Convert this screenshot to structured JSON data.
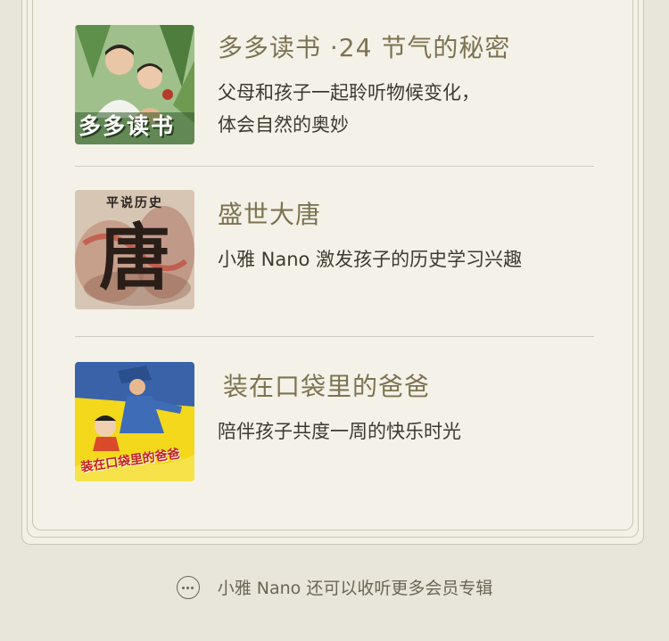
{
  "albums": [
    {
      "title": "多多读书 ·24 节气的秘密",
      "desc_lines": [
        "父母和孩子一起聆听物候变化，",
        "体会自然的奥妙"
      ],
      "cover_text": "多多读书"
    },
    {
      "title": "盛世大唐",
      "desc_lines": [
        "小雅 Nano 激发孩子的历史学习兴趣"
      ],
      "cover_top": "平说历史",
      "cover_text": "唐"
    },
    {
      "title": "装在口袋里的爸爸",
      "desc_lines": [
        "陪伴孩子共度一周的快乐时光"
      ],
      "cover_text": "装在口袋里的爸爸"
    }
  ],
  "footer": {
    "more_label": "小雅 Nano 还可以收听更多会员专辑",
    "icon": "more-dots-icon"
  },
  "colors": {
    "background": "#e8e6da",
    "card": "#f4f2e8",
    "title": "#7d7352",
    "text": "#3d3a30"
  }
}
